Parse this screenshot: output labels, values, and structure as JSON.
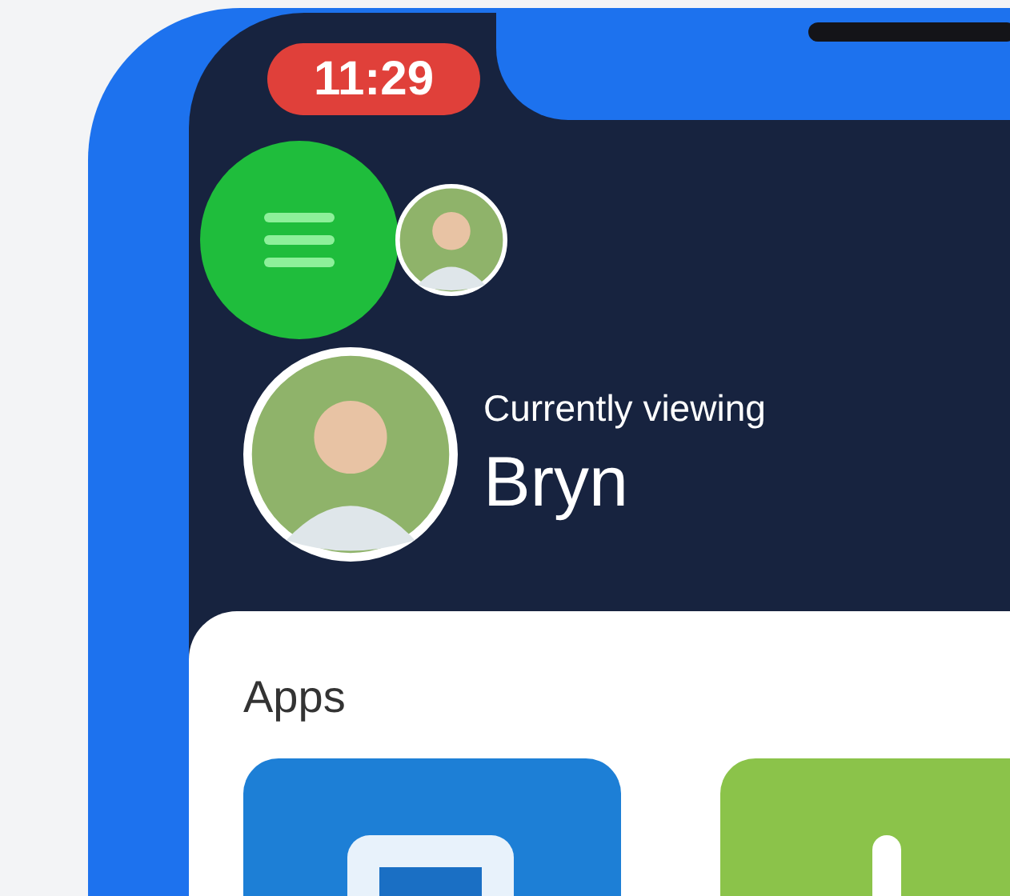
{
  "status_bar": {
    "time": "11:29"
  },
  "header": {
    "viewing_label": "Currently viewing",
    "profile_name": "Bryn"
  },
  "apps": {
    "title": "Apps",
    "tiles": [
      {
        "kind": "square",
        "color": "#1d7fd6"
      },
      {
        "kind": "bar",
        "color": "#8bc34a"
      }
    ]
  }
}
